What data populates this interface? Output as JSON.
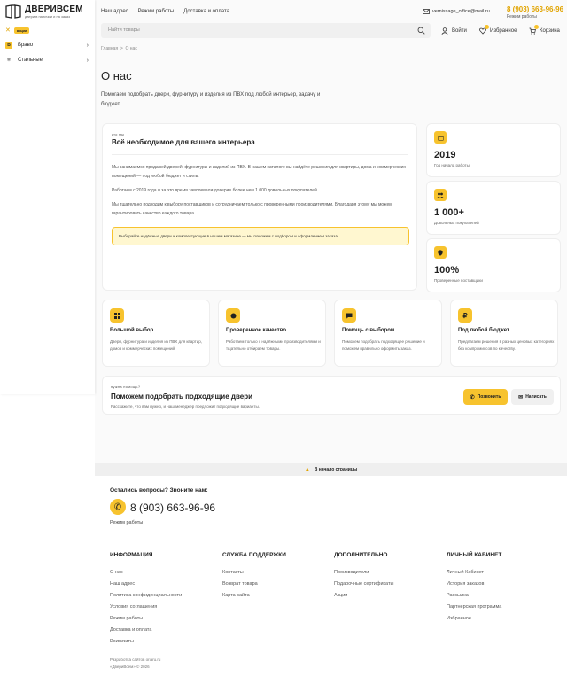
{
  "brand": {
    "name": "ДВЕРИВСЕМ",
    "tagline": "двери в наличии и на заказ"
  },
  "catalog": {
    "badge": "акции"
  },
  "sidebar": {
    "items": [
      {
        "label": "Браво",
        "icon": "b-icon",
        "icon_text": "B"
      },
      {
        "label": "Стальные",
        "icon": "gear-icon",
        "icon_text": "✱"
      }
    ]
  },
  "topnav": {
    "items": [
      "Наш адрес",
      "Режим работы",
      "Доставка и оплата"
    ]
  },
  "contact": {
    "email": "vernissage_office@mail.ru",
    "phone": "8 (903) 663-96-96",
    "phone_sub": "Режим работы"
  },
  "search": {
    "placeholder": "Найти товары"
  },
  "actions": {
    "login": "Войти",
    "favorites": "Избранное",
    "cart": "Корзина"
  },
  "breadcrumb": {
    "home": "Главная",
    "sep": ">",
    "current": "О нас"
  },
  "page": {
    "title": "О нас",
    "intro": "Помогаем подобрать двери, фурнитуру и изделия из ПВХ под любой интерьер, задачу и бюджет."
  },
  "about": {
    "eyebrow": "кто мы",
    "title": "Всё необходимое для вашего интерьера",
    "p1": "Мы занимаемся продажей дверей, фурнитуры и изделий из ПВХ. В нашем каталоге вы найдёте решения для квартиры, дома и коммерческих помещений — под любой бюджет и стиль.",
    "p2": "Работаем с 2019 года и за это время заволевали доверие более чем 1 000 довольных покупателей.",
    "p3": "Мы тщательно подходим к выбору поставщиков и сотрудничаем только с проверенными производителями. Благодаря этому мы можем гарантировать качество каждого товара.",
    "note": "Выбирайте надёжные двери и комплектующие в нашем магазине — мы поможем с подбором и оформлением заказа."
  },
  "stats": [
    {
      "num": "2019",
      "label": "Год начала работы",
      "icon": "calendar-icon"
    },
    {
      "num": "1 000+",
      "label": "Довольных покупателей",
      "icon": "users-icon"
    },
    {
      "num": "100%",
      "label": "Проверенные поставщики",
      "icon": "shield-icon"
    }
  ],
  "features": [
    {
      "title": "Большой выбор",
      "desc": "Двери, фурнитура и изделия из ПВХ для квартир, домов и коммерческих помещений.",
      "icon": "grid-icon"
    },
    {
      "title": "Проверенное качество",
      "desc": "Работаем только с надёжными производителями и тщательно отбираем товары.",
      "icon": "badge-icon"
    },
    {
      "title": "Помощь с выбором",
      "desc": "Поможем подобрать подходящее решение и поможем правильно оформить заказ.",
      "icon": "chat-icon"
    },
    {
      "title": "Под любой бюджет",
      "desc": "Предлагаем решения в разных ценовых категориях без компромиссов по качеству.",
      "icon": "ruble-icon"
    }
  ],
  "cta": {
    "eyebrow": "нужна помощь?",
    "title": "Поможем подобрать подходящие двери",
    "sub": "Расскажите, что вам нужно, и наш менеджер предложит подходящие варианты.",
    "call": "Позвонить",
    "write": "Написать"
  },
  "totop": {
    "label": "В начало страницы"
  },
  "footer": {
    "question": "Остались вопросы? Звоните нам:",
    "phone": "8 (903) 663-96-96",
    "hours": "Режим работы",
    "columns": [
      {
        "title": "ИНФОРМАЦИЯ",
        "links": [
          "О нас",
          "Наш адрес",
          "Политика конфиденциальности",
          "Условия соглашения",
          "Режим работы",
          "Доставка и оплата",
          "Реквизиты"
        ]
      },
      {
        "title": "СЛУЖБА ПОДДЕРЖКИ",
        "links": [
          "Контакты",
          "Возврат товара",
          "Карта сайта"
        ]
      },
      {
        "title": "ДОПОЛНИТЕЛЬНО",
        "links": [
          "Производители",
          "Подарочные сертификаты",
          "Акции"
        ]
      },
      {
        "title": "ЛИЧНЫЙ КАБИНЕТ",
        "links": [
          "Личный Кабинет",
          "История заказов",
          "Рассылка",
          "Партнерская программа",
          "Избранное"
        ]
      }
    ],
    "dev": "Разработка сайтов oriaru.ru",
    "copyright": "«ДвериВсем» © 2026"
  },
  "colors": {
    "accent": "#f7c32e",
    "phone": "#e1a400"
  }
}
